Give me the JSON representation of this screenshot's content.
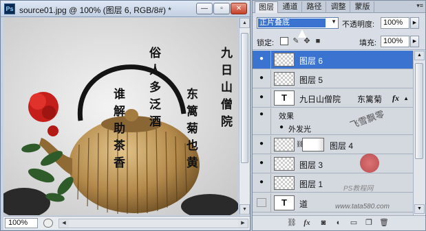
{
  "document": {
    "title": "source01.jpg @ 100% (图层 6, RGB/8#) *",
    "app_icon": "Ps",
    "min_label": "—",
    "max_label": "▫",
    "close_label": "✕",
    "zoom": "100%",
    "canvas_text": {
      "col1": "九日山僧院",
      "col2": "东篱菊也黄",
      "col3": "俗人多泛酒",
      "col4": "谁解助茶香"
    }
  },
  "panel": {
    "tabs": [
      "图层",
      "通道",
      "路径",
      "调整",
      "蒙版"
    ],
    "blend_mode": "正片叠底",
    "opacity_label": "不透明度:",
    "opacity_value": "100%",
    "lock_label": "锁定:",
    "fill_label": "填充:",
    "fill_value": "100%",
    "layers": [
      {
        "name": "图层 6",
        "selected": true,
        "visible": true,
        "kind": "pixel"
      },
      {
        "name": "图层 5",
        "selected": false,
        "visible": true,
        "kind": "pixel"
      },
      {
        "name": "九日山僧院　　东篱菊...",
        "selected": false,
        "visible": true,
        "kind": "text",
        "fx": "fx"
      },
      {
        "name": "效果",
        "selected": false,
        "visible": true,
        "kind": "effect"
      },
      {
        "name": "外发光",
        "selected": false,
        "visible": true,
        "kind": "effect-item"
      },
      {
        "name": "图层 4",
        "selected": false,
        "visible": true,
        "kind": "masked"
      },
      {
        "name": "图层 3",
        "selected": false,
        "visible": true,
        "kind": "pixel"
      },
      {
        "name": "图层 1",
        "selected": false,
        "visible": true,
        "kind": "pixel"
      },
      {
        "name": "道",
        "selected": false,
        "visible": false,
        "kind": "text"
      }
    ],
    "text_thumb_glyph": "T",
    "fx_label": "fx",
    "watermark_line1": "PS教程网",
    "watermark_line2": "www.tata580.com",
    "signature_text": "飞雪飘零"
  },
  "colors": {
    "selection_blue": "#3a73d0",
    "panel_bg": "#d9dee6",
    "window_frame": "#c7d3e2"
  }
}
